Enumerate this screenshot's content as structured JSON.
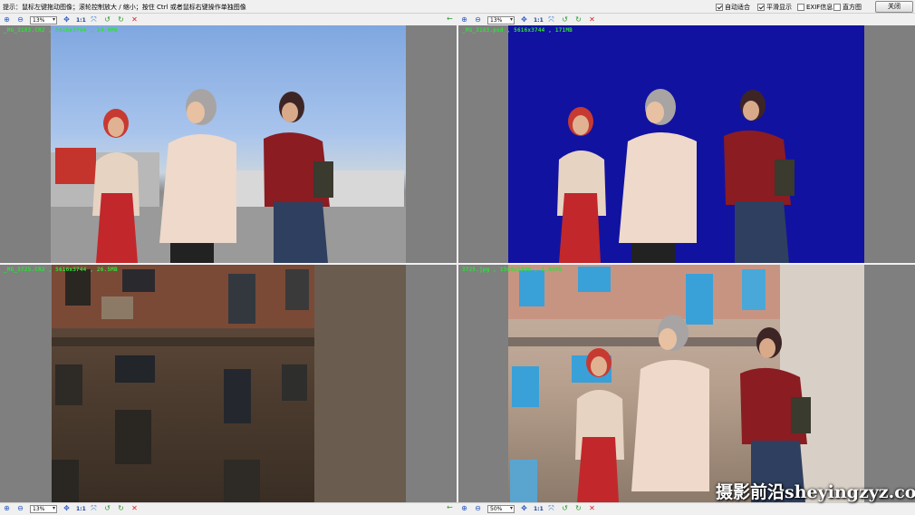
{
  "topbar": {
    "hint": "提示：鼠标左键拖动图像；滚轮控制放大 / 缩小；按住 Ctrl 或者鼠标右键操作单独图像",
    "options": [
      {
        "label": "自动适合",
        "checked": true
      },
      {
        "label": "平滑显示",
        "checked": true
      },
      {
        "label": "EXIF信息",
        "checked": false
      },
      {
        "label": "直方图",
        "checked": false
      }
    ],
    "close_label": "关闭"
  },
  "toolbars": {
    "one_to_one": "1:1",
    "top_left_zoom": "13%",
    "top_right_zoom": "13%",
    "bottom_left_zoom": "13%",
    "bottom_right_zoom": "50%"
  },
  "panes": {
    "top_left": {
      "info": "_MG_3183.CR2 , 5616x3744 , 24.8MB"
    },
    "top_right": {
      "info": "_MG_3183.psd , 5616x3744 , 171MB"
    },
    "bottom_left": {
      "info": "_MG_3725.CR2 , 5616x3744 , 26.5MB"
    },
    "bottom_right": {
      "info": "3725.jpg , 1500x1000 , 1.08MB"
    }
  },
  "watermark": "摄影前沿sheyingzyz.com",
  "icons": [
    "zoom-in-icon",
    "zoom-out-icon",
    "fit-icon",
    "rotate-left-icon",
    "rotate-right-icon",
    "close-icon",
    "arrow-left-icon"
  ]
}
